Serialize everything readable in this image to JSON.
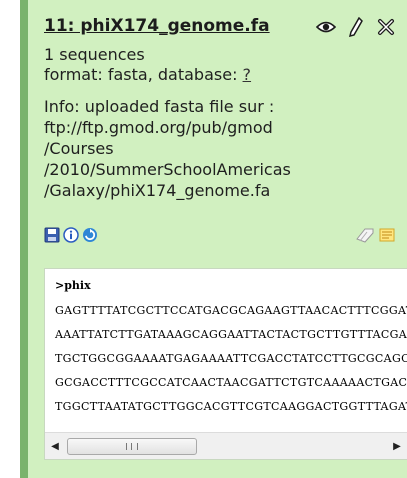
{
  "dataset": {
    "title": "11: phiX174_genome.fa",
    "sequences": "1 sequences",
    "format_prefix": "format: fasta, database:",
    "database_value": "?",
    "info_lines": [
      "Info: uploaded fasta file sur :",
      "ftp://ftp.gmod.org/pub/gmod",
      "/Courses",
      "/2010/SummerSchoolAmericas",
      "/Galaxy/phiX174_genome.fa"
    ],
    "icons": {
      "view": "eye-icon",
      "edit": "pencil-icon",
      "delete": "delete-icon",
      "save": "save-icon",
      "info": "info-icon",
      "rerun": "rerun-icon",
      "tag": "tag-icon",
      "annotate": "annotation-icon"
    },
    "colors": {
      "panel_bg": "#d1f0c0",
      "panel_border": "#7ab36c"
    }
  },
  "peek": {
    "header": ">phix",
    "lines": [
      "GAGTTTTATCGCTTCCATGACGCAGAAGTTAACACTTTCGGATATTTCTG",
      "AAATTATCTTGATAAAGCAGGAATTACTACTGCTTGTTTACGAATTAAATC",
      "TGCTGGCGGAAAATGAGAAAATTCGACCTATCCTTGCGCAGCTCGAGAAG",
      "GCGACCTTTCGCCATCAACTAACGATTCTGTCAAAAACTGACGCGTTGGA",
      "TGGCTTAATATGCTTGGCACGTTCGTCAAGGACTGGTTTAGATATGAGTCA"
    ],
    "scroll_mark": "III"
  }
}
